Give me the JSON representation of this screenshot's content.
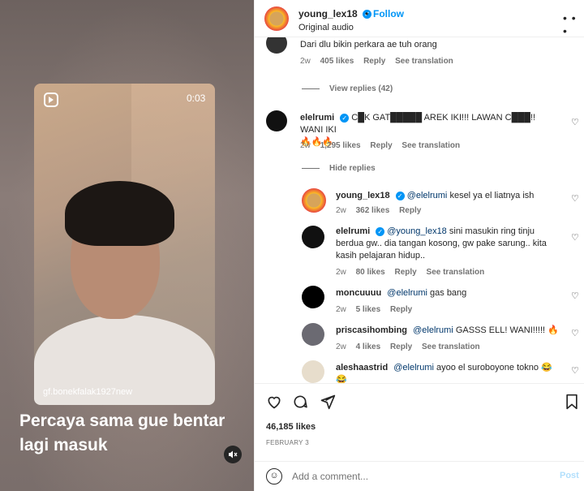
{
  "media": {
    "duration": "0:03",
    "watermark": "gf.bonekfalak1927new",
    "caption": "Percaya sama gue bentar lagi masuk",
    "reel_icon": "reels-icon",
    "mute_icon": "volume-muted-icon"
  },
  "header": {
    "username": "young_lex18",
    "verified_icon": "verified-badge-icon",
    "separator": "•",
    "follow_label": "Follow",
    "audio": "Original audio",
    "more_label": "• • •"
  },
  "comments": {
    "c0": {
      "text": "Dari dlu bikin perkara ae tuh orang",
      "age": "2w",
      "likes": "405 likes",
      "reply": "Reply",
      "translate": "See translation",
      "view_replies": "View replies (42)"
    },
    "c1": {
      "user": "elelrumi",
      "text": "C█K GAT█████ AREK IKI!!! LAWAN C███!! WANI IKI",
      "emoji": "🔥🔥🔥",
      "age": "2w",
      "likes": "1,295 likes",
      "reply": "Reply",
      "translate": "See translation",
      "hide_replies": "Hide replies"
    },
    "r1": {
      "user": "young_lex18",
      "mention": "@elelrumi",
      "text": " kesel ya el liatnya ish",
      "age": "2w",
      "likes": "362 likes",
      "reply": "Reply"
    },
    "r2": {
      "user": "elelrumi",
      "mention": "@young_lex18",
      "text": " sini masukin ring tinju berdua gw.. dia tangan kosong, gw pake sarung.. kita kasih pelajaran hidup..",
      "age": "2w",
      "likes": "80 likes",
      "reply": "Reply",
      "translate": "See translation"
    },
    "r3": {
      "user": "moncuuuu",
      "mention": "@elelrumi",
      "text": " gas bang",
      "age": "2w",
      "likes": "5 likes",
      "reply": "Reply"
    },
    "r4": {
      "user": "priscasihombing",
      "mention": "@elelrumi",
      "text": " GASSS ELL! WANI!!!!! 🔥",
      "age": "2w",
      "likes": "4 likes",
      "reply": "Reply",
      "translate": "See translation"
    },
    "r5": {
      "user": "aleshaastrid",
      "mention": "@elelrumi",
      "text": " ayoo el suroboyone tokno 😂",
      "emoji2": "😂"
    }
  },
  "actions": {
    "likes": "46,185 likes",
    "date": "FEBRUARY 3"
  },
  "add_comment": {
    "placeholder": "Add a comment...",
    "post_label": "Post"
  }
}
